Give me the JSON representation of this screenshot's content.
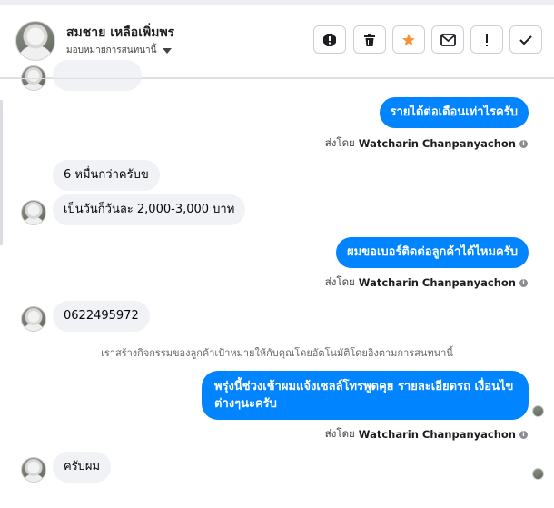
{
  "header": {
    "name": "สมชาย เหลือเพิ่มพร",
    "assign_label": "มอบหมายการสนทนานี้"
  },
  "actions": [
    {
      "name": "spam-button",
      "icon": "exclamation-octagon-icon"
    },
    {
      "name": "delete-button",
      "icon": "trash-icon"
    },
    {
      "name": "star-button",
      "icon": "star-icon"
    },
    {
      "name": "mark-unread-button",
      "icon": "envelope-icon"
    },
    {
      "name": "follow-up-button",
      "icon": "exclamation-icon"
    },
    {
      "name": "mark-done-button",
      "icon": "checkmark-icon"
    }
  ],
  "colors": {
    "accent": "#0084ff",
    "star": "#f7923b",
    "incoming_bg": "#f0f2f5"
  },
  "messages": {
    "m1": "รายได้ต่อเดือนเท่าไรครับ",
    "m2": "6 หมื่นกว่าครับข",
    "m3": "เป็นวันก็วันละ 2,000-3,000 บาท",
    "m4": "ผมขอเบอร์ติดต่อลูกค้าได้ไหมครับ",
    "m5": "0622495972",
    "m6_line1": "พรุ่งนี้ช่วงเช้าผมแจ้งเซลล์โทรพูดคุย รายละเอียดรถ เงื่อนไข",
    "m6_line2": "ต่างๆนะครับ",
    "m7": "ครับผม"
  },
  "sent_by": {
    "prefix": "ส่งโดย",
    "agent": "Watcharin Chanpanyachon"
  },
  "system_note": "เราสร้างกิจกรรมของลูกค้าเป้าหมายให้กับคุณโดยอัตโนมัติโดยอิงตามการสนทนานี้"
}
